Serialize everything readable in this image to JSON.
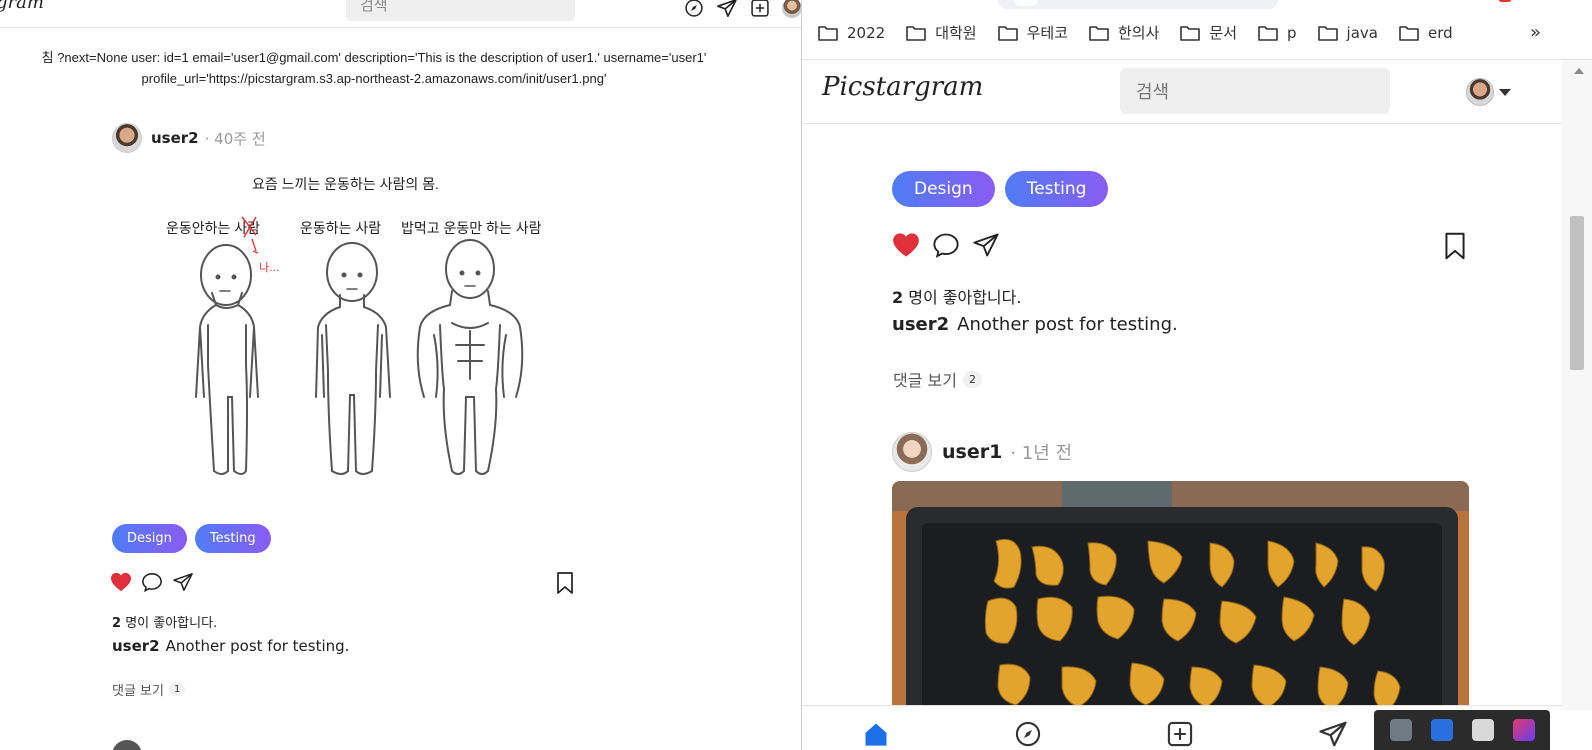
{
  "left_window": {
    "logo": "gram",
    "search_placeholder": "검색",
    "debug_line1": "침 ?next=None user: id=1 email='user1@gmail.com' description='This is the description of user1.' username='user1'",
    "debug_line2": "profile_url='https://picstargram.s3.ap-northeast-2.amazonaws.com/init/user1.png'",
    "post": {
      "username": "user2",
      "time": "· 40주 전",
      "meme": {
        "title": "요즘 느끼는 운동하는 사람의 몸.",
        "labels": [
          "운동안하는 사람",
          "운동하는 사람",
          "밥먹고 운동만 하는 사람"
        ],
        "scribble": "나..."
      },
      "tags": [
        "Design",
        "Testing"
      ],
      "likes_count": "2",
      "likes_suffix": "명이 좋아합니다.",
      "caption_user": "user2",
      "caption_text": "Another post for testing.",
      "comments_label": "댓글 보기",
      "comments_count": "1"
    }
  },
  "right_window": {
    "bookmarks": [
      "2022",
      "대학원",
      "우테코",
      "한의사",
      "문서",
      "p",
      "java",
      "erd"
    ],
    "bookmarks_more": "»",
    "logo": "Picstargram",
    "search_placeholder": "검색",
    "post_top": {
      "tags": [
        "Design",
        "Testing"
      ],
      "likes_count": "2",
      "likes_suffix": "명이 좋아합니다.",
      "caption_user": "user2",
      "caption_text": "Another post for testing.",
      "comments_label": "댓글 보기",
      "comments_count": "2"
    },
    "post_next": {
      "username": "user1",
      "time": "· 1년 전"
    }
  },
  "colors": {
    "tag_gradient_start": "#4f7cf7",
    "tag_gradient_end": "#8a5cf5",
    "heart": "#e0303b",
    "nav_home": "#1e6fe8"
  },
  "icons": [
    "explore-icon",
    "send-icon",
    "add-post-icon",
    "heart-icon",
    "comment-icon",
    "bookmark-icon",
    "folder-icon",
    "home-icon"
  ]
}
